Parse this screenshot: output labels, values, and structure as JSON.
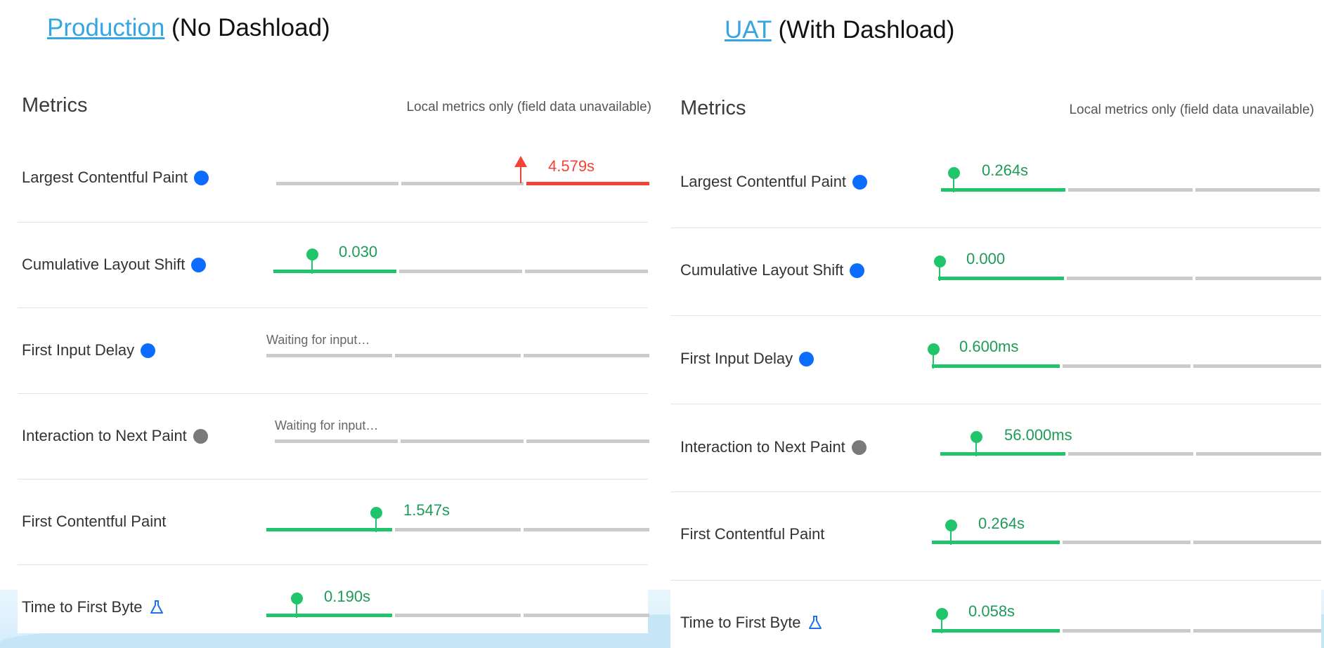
{
  "left": {
    "link": "Production",
    "suffix": " (No Dashload)",
    "metrics_title": "Metrics",
    "note": "Local metrics only (field data unavailable)",
    "rows": [
      {
        "name": "Largest Contentful Paint",
        "indicator": "blue-dot",
        "value": "4.579s",
        "status": "poor"
      },
      {
        "name": "Cumulative Layout Shift",
        "indicator": "blue-dot",
        "value": "0.030",
        "status": "good"
      },
      {
        "name": "First Input Delay",
        "indicator": "blue-dot",
        "value": "Waiting for input…",
        "status": "waiting"
      },
      {
        "name": "Interaction to Next Paint",
        "indicator": "gray-dot",
        "value": "Waiting for input…",
        "status": "waiting"
      },
      {
        "name": "First Contentful Paint",
        "indicator": "none",
        "value": "1.547s",
        "status": "good"
      },
      {
        "name": "Time to First Byte",
        "indicator": "flask-icon",
        "value": "0.190s",
        "status": "good"
      }
    ]
  },
  "right": {
    "link": "UAT",
    "suffix": " (With Dashload)",
    "metrics_title": "Metrics",
    "note": "Local metrics only (field data unavailable)",
    "rows": [
      {
        "name": "Largest Contentful Paint",
        "indicator": "blue-dot",
        "value": "0.264s",
        "status": "good"
      },
      {
        "name": "Cumulative Layout Shift",
        "indicator": "blue-dot",
        "value": "0.000",
        "status": "good"
      },
      {
        "name": "First Input Delay",
        "indicator": "blue-dot",
        "value": "0.600ms",
        "status": "good"
      },
      {
        "name": "Interaction to Next Paint",
        "indicator": "gray-dot",
        "value": "56.000ms",
        "status": "good"
      },
      {
        "name": "First Contentful Paint",
        "indicator": "none",
        "value": "0.264s",
        "status": "good"
      },
      {
        "name": "Time to First Byte",
        "indicator": "flask-icon",
        "value": "0.058s",
        "status": "good"
      }
    ]
  },
  "colors": {
    "good": "#1fc46b",
    "poor": "#f44336",
    "blue_dot": "#0b6cff",
    "gray_dot": "#7a7a7a",
    "link": "#35a6e2"
  }
}
